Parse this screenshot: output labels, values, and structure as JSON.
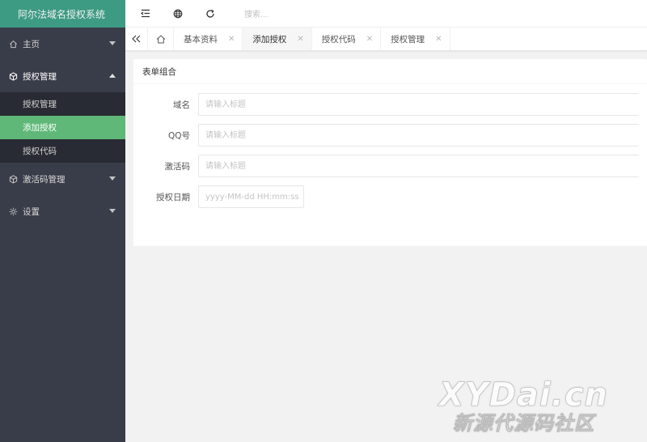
{
  "app": {
    "title": "阿尔法域名授权系统",
    "brand_color": "#3d9b84",
    "sidebar_bg": "#393d49",
    "active_color": "#5fb878"
  },
  "sidebar": {
    "items": [
      {
        "label": "主页",
        "icon": "home-icon"
      },
      {
        "label": "授权管理",
        "icon": "cube-icon",
        "open": true,
        "children": [
          {
            "label": "授权管理"
          },
          {
            "label": "添加授权",
            "active": true
          },
          {
            "label": "授权代码"
          }
        ]
      },
      {
        "label": "激活码管理",
        "icon": "cube-icon"
      },
      {
        "label": "设置",
        "icon": "gear-icon"
      }
    ]
  },
  "header": {
    "search_placeholder": "搜索..."
  },
  "tabs": [
    {
      "label": "基本资料"
    },
    {
      "label": "添加授权",
      "active": true
    },
    {
      "label": "授权代码"
    },
    {
      "label": "授权管理"
    }
  ],
  "form": {
    "title": "表单组合",
    "fields": [
      {
        "label": "域名",
        "placeholder": "请输入标题"
      },
      {
        "label": "QQ号",
        "placeholder": "请输入标题"
      },
      {
        "label": "激活码",
        "placeholder": "请输入标题"
      },
      {
        "label": "授权日期",
        "placeholder": "yyyy-MM-dd HH:mm:ss"
      }
    ]
  },
  "watermark": {
    "line1": "XYDai.cn",
    "line2": "新源代源码社区"
  }
}
